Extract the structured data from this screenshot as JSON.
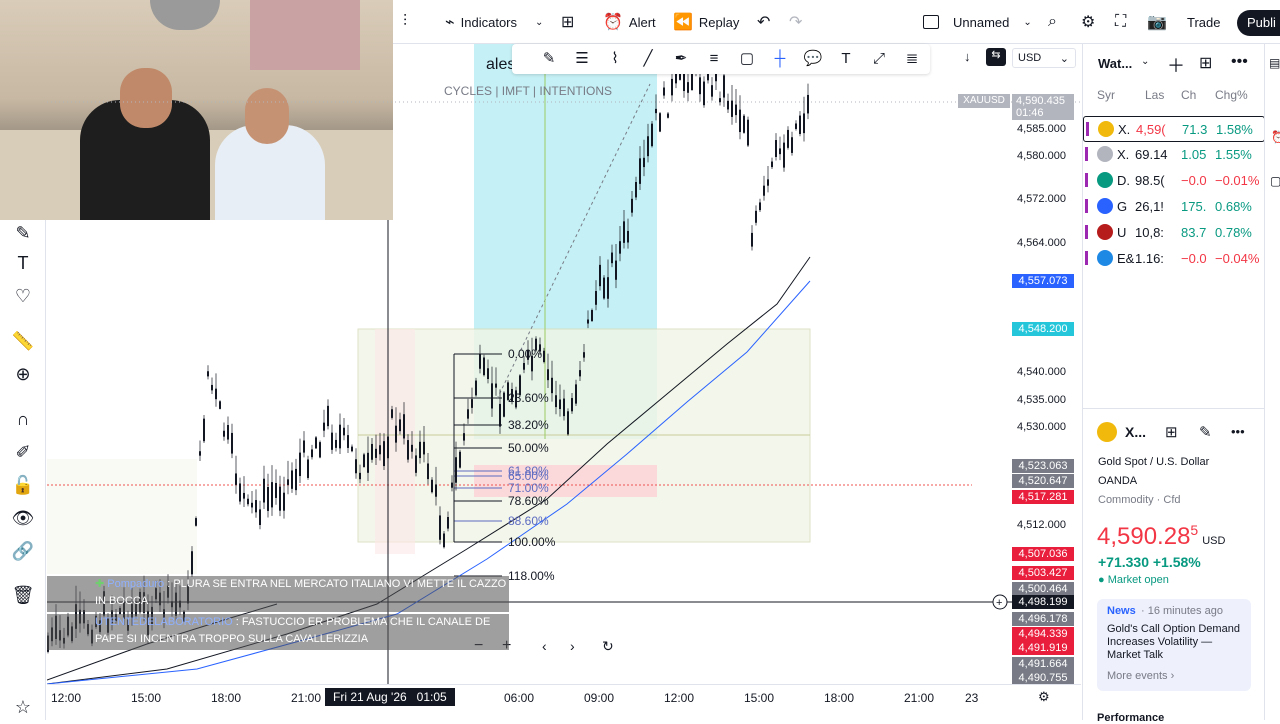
{
  "topbar": {
    "indicators": "Indicators",
    "alert": "Alert",
    "replay": "Replay",
    "layout_name": "Unnamed",
    "trade": "Trade",
    "publish": "Publi"
  },
  "chart": {
    "symbol_partial": "ales",
    "indicator_labels": "CYCLES  | IMFT |  INTENTIONS",
    "currency": "USD",
    "symbol_tag": "XAUUSD",
    "current_price": "4,590.435",
    "countdown": "01:46",
    "crosshair_price": "4,498.199",
    "crosshair_time": "Fri 21 Aug '26   01:05",
    "price_labels": [
      "4,585.000",
      "4,580.000",
      "4,572.000",
      "4,564.000",
      "4,540.000",
      "4,535.000",
      "4,530.000",
      "4,512.000"
    ],
    "price_boxes": [
      {
        "v": "4,557.073",
        "c": "#2962ff"
      },
      {
        "v": "4,548.200",
        "c": "#26c6da"
      },
      {
        "v": "4,523.063",
        "c": "#787b86"
      },
      {
        "v": "4,520.647",
        "c": "#787b86"
      },
      {
        "v": "4,517.281",
        "c": "#e91e3c"
      },
      {
        "v": "4,507.036",
        "c": "#e91e3c"
      },
      {
        "v": "4,503.427",
        "c": "#e91e3c"
      },
      {
        "v": "4,500.464",
        "c": "#787b86"
      },
      {
        "v": "4,496.178",
        "c": "#787b86"
      },
      {
        "v": "4,494.339",
        "c": "#e91e3c"
      },
      {
        "v": "4,491.919",
        "c": "#e91e3c"
      },
      {
        "v": "4,491.664",
        "c": "#787b86"
      },
      {
        "v": "4,490.755",
        "c": "#787b86"
      }
    ],
    "time_labels": [
      "12:00",
      "15:00",
      "18:00",
      "21:00",
      "06:00",
      "09:00",
      "12:00",
      "15:00",
      "18:00",
      "21:00",
      "23"
    ],
    "fib_levels": [
      "0.00%",
      "23.60%",
      "38.20%",
      "50.00%",
      "61.80%",
      "65.00%",
      "71.00%",
      "78.60%",
      "88.60%",
      "100.00%",
      "118.00%"
    ]
  },
  "chat": [
    {
      "user": "Pompaduro",
      "text": " : PLURA SE ENTRA NEL MERCATO ITALIANO VI METTE IL CAZZO IN BOCCA"
    },
    {
      "user": "UTENTEDELABORATORIO",
      "text": " : FASTUCCIO ER PROBLEMA CHE IL CANALE DE PAPE SI INCENTRA TROPPO SULLA CAVALLERIZZIA"
    }
  ],
  "watchlist": {
    "title": "Wat...",
    "columns": [
      "Syr",
      "Las",
      "Ch",
      "Chg%"
    ],
    "rows": [
      {
        "sym": "X.",
        "last": "4,59(",
        "chg": "71.3",
        "pct": "1.58%",
        "color": "#089981",
        "badge": "#f0b90b"
      },
      {
        "sym": "X.",
        "last": "69.14",
        "chg": "1.05",
        "pct": "1.55%",
        "color": "#089981",
        "badge": "#b2b5be"
      },
      {
        "sym": "D.",
        "last": "98.5(",
        "chg": "−0.0",
        "pct": "−0.01%",
        "color": "#f23645",
        "badge": "#089981"
      },
      {
        "sym": "G",
        "last": "26,1!",
        "chg": "175.",
        "pct": "0.68%",
        "color": "#089981",
        "badge": "#2962ff"
      },
      {
        "sym": "U",
        "last": "10,8:",
        "chg": "83.7",
        "pct": "0.78%",
        "color": "#089981",
        "badge": "#b71c1c"
      },
      {
        "sym": "E&",
        "last": "1.16:",
        "chg": "−0.0",
        "pct": "−0.04%",
        "color": "#f23645",
        "badge": "#1e88e5"
      }
    ]
  },
  "details": {
    "symbol": "X...",
    "name": "Gold Spot / U.S. Dollar",
    "broker": "OANDA",
    "category": "Commodity · Cfd",
    "price_main": "4,590.28",
    "price_sup": "5",
    "currency": "USD",
    "change": "+71.330 +1.58%",
    "market_status": "Market open",
    "news_label": "News",
    "news_time": "· 16 minutes ago",
    "news_headline": "Gold's Call Option Demand Increases Volatility — Market Talk",
    "more_events": "More events ›",
    "performance": "Performance"
  }
}
